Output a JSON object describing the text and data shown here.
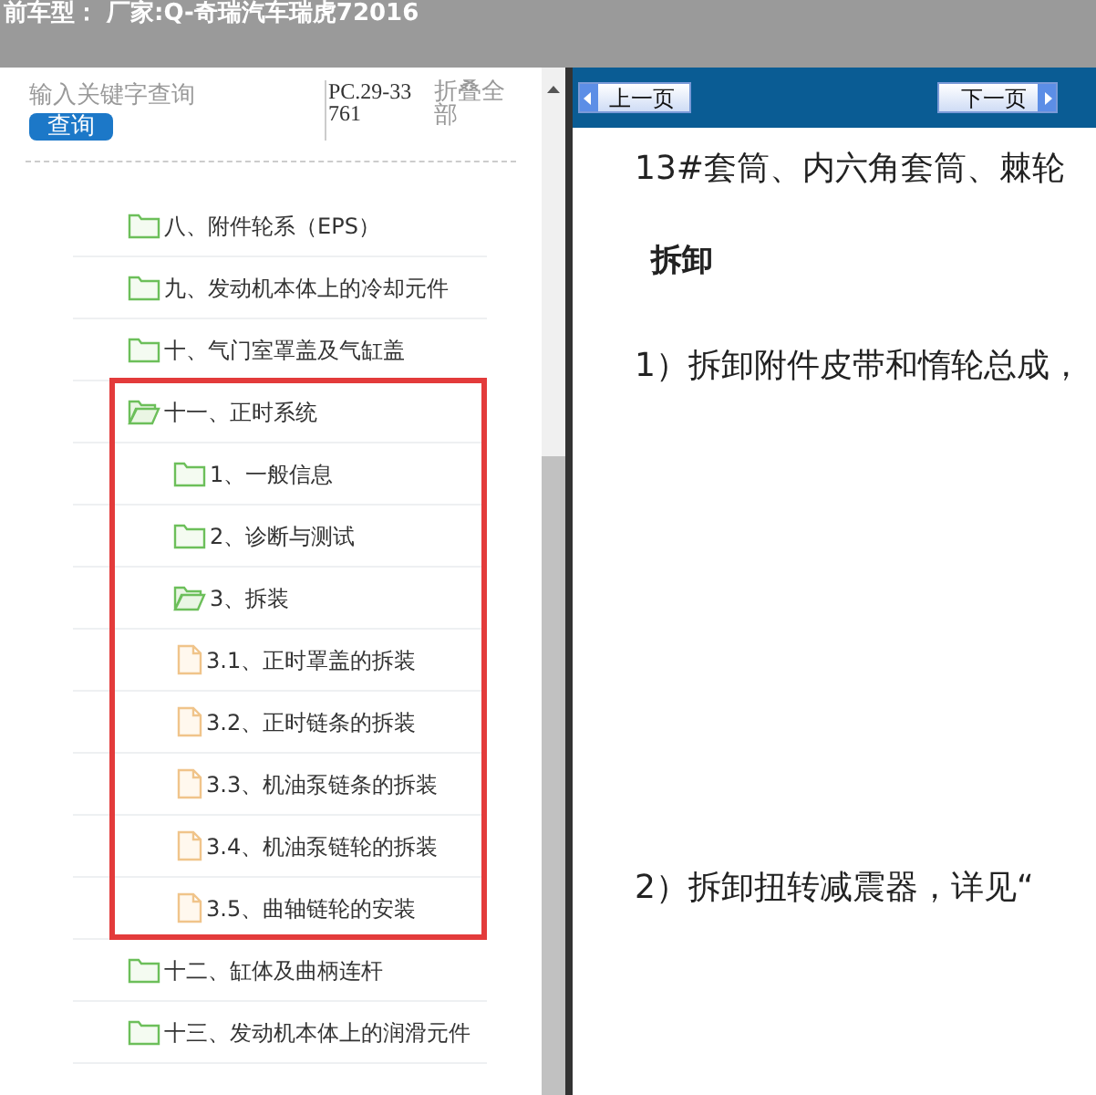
{
  "header": {
    "title": "前车型： 厂家:Q-奇瑞汽车瑞虎72016"
  },
  "search": {
    "placeholder": "输入关键字查询",
    "button": "查询",
    "code": "PC.29-33761",
    "collapse_link": "折叠全部"
  },
  "tree": [
    {
      "label": "八、附件轮系（EPS）",
      "kind": "folder",
      "expanded": false,
      "highlighted": false
    },
    {
      "label": "九、发动机本体上的冷却元件",
      "kind": "folder",
      "expanded": false,
      "highlighted": false
    },
    {
      "label": "十、气门室罩盖及气缸盖",
      "kind": "folder",
      "expanded": false,
      "highlighted": false
    },
    {
      "label": "十一、正时系统",
      "kind": "folder",
      "expanded": true,
      "highlighted": true,
      "children": [
        {
          "label": "1、一般信息",
          "kind": "folder",
          "expanded": false,
          "highlighted": false
        },
        {
          "label": "2、诊断与测试",
          "kind": "folder",
          "expanded": false,
          "highlighted": false
        },
        {
          "label": "3、拆装",
          "kind": "folder",
          "expanded": true,
          "highlighted": false,
          "children": [
            {
              "label": "3.1、正时罩盖的拆装",
              "kind": "file",
              "highlighted": false
            },
            {
              "label": "3.2、正时链条的拆装",
              "kind": "file",
              "highlighted": false
            },
            {
              "label": "3.3、机油泵链条的拆装",
              "kind": "file",
              "highlighted": false
            },
            {
              "label": "3.4、机油泵链轮的拆装",
              "kind": "file",
              "highlighted": false
            },
            {
              "label": "3.5、曲轴链轮的安装",
              "kind": "file",
              "highlighted": false
            }
          ]
        }
      ]
    },
    {
      "label": "十二、缸体及曲柄连杆",
      "kind": "folder",
      "expanded": false,
      "highlighted": false
    },
    {
      "label": "十三、发动机本体上的润滑元件",
      "kind": "folder",
      "expanded": false,
      "highlighted": false
    }
  ],
  "toolbar": {
    "prev": "上一页",
    "next": "下一页"
  },
  "document": [
    {
      "kind": "paragraph",
      "text": "13#套筒、内六角套筒、棘轮"
    },
    {
      "kind": "heading",
      "text": "拆卸"
    },
    {
      "kind": "paragraph",
      "text": "1）拆卸附件皮带和惰轮总成，"
    },
    {
      "kind": "figure"
    },
    {
      "kind": "paragraph",
      "text": "2）拆卸扭转减震器，详见“"
    }
  ]
}
